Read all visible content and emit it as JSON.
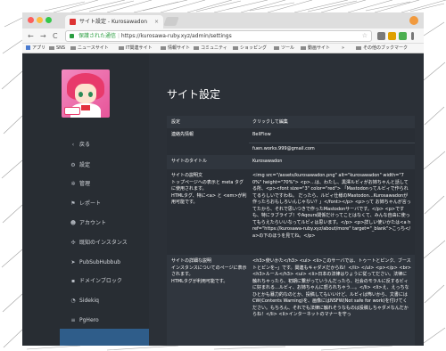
{
  "browser": {
    "tab_title": "サイト設定 - Kurosawadon",
    "tab_close": "×",
    "secure_label": "保護された通信",
    "url": "https://kurosawa-ruby.xyz/admin/settings",
    "nav_back": "←",
    "nav_forward": "→",
    "nav_reload": "C",
    "star": "☆",
    "bookmarks": [
      "アプリ",
      "SNS",
      "ニュースサイト",
      "IT関連サイト",
      "情報サイト",
      "コミュニティ",
      "ショッピング",
      "ツール",
      "動画サイト"
    ],
    "bookmarks_more": "»",
    "bookmarks_other": "その他のブックマーク"
  },
  "sidebar": {
    "items": [
      {
        "label": "戻る",
        "icon": "chevron-left-icon",
        "glyph": "‹"
      },
      {
        "label": "設定",
        "icon": "gear-icon",
        "glyph": "⚙"
      },
      {
        "label": "管理",
        "icon": "cogs-icon",
        "glyph": "✲"
      },
      {
        "label": "レポート",
        "icon": "flag-icon",
        "glyph": "⚑"
      },
      {
        "label": "アカウント",
        "icon": "users-icon",
        "glyph": "☻"
      },
      {
        "label": "既知のインスタンス",
        "icon": "network-icon",
        "glyph": "✣"
      },
      {
        "label": "PubSubHubbub",
        "icon": "paper-plane-icon",
        "glyph": "➤"
      },
      {
        "label": "ドメインブロック",
        "icon": "lock-icon",
        "glyph": "▪"
      },
      {
        "label": "Sidekiq",
        "icon": "wifi-icon",
        "glyph": "◔"
      },
      {
        "label": "PgHero",
        "icon": "database-icon",
        "glyph": "≡"
      }
    ]
  },
  "main": {
    "title": "サイト設定",
    "header": {
      "label": "設定",
      "value": "クリックして編集"
    },
    "contact": {
      "label": "連絡先情報",
      "username": "BellFlow",
      "email": "fuen.works.999@gmail.com"
    },
    "site_title": {
      "label": "サイトのタイトル",
      "value": "Kurosawadon"
    },
    "description": {
      "label": "サイトの説明文",
      "note": "トップページへの表示と meta タグに使用されます。",
      "note2": "HTMLタグ、特に<a> と <em>が利用可能です。",
      "value": "<img src=\"/assets/kurosawadon.png\" alt=\"kurosawadon\" width=\"70%\" height=\"70%\"> <p>…は、わたし、黒澤ルビィがお姉ちゃんと話してる所、<p><font size=\"3\" color=\"red\"> 「Mastodonってルビィで作られてるらしいですわね。 だったら、ルビィ仕様のMastodon…Kurosawadonが作ったらおもしろいんじゃない？」</font></p> <p>って お姉ちゃんが言ってたから、それで思いつきで作ったMastodonサーバです。</p> <p>ですも、特にラブライブ！やAqours関係だけってことはなくて、みんな自由に使ってもらえたらいいなってルビィは思います。</p> <p>詳しい使いかたは<a href=\"https://kurosawa-ruby.xyz/about/more\" target=\"_blank\">こっち</a>の下のほうを見てね。</p>"
    },
    "extended": {
      "label": "サイトの詳細な説明",
      "note": "インスタンスについてのページに表示されます。",
      "note2": "HTMLタグが利用可能です。",
      "value": "<h3>使いかた</h3> <ul> <li>このサーバでは、トゥートとピンク、ブーストとピンを─」です。関連もキャダメだからね！</li> </ul> <p></p> <br> <h3>ルール</h3> <ul> <li>日本の法律はりょうに従ってださい。法律に触れちゃったら、初期に繋がっていうんだったら、社会のモラルに反するビィに好まれる…ルビィ、お姉ちゃんに怒られちゃう…。</li> <li>え、えっちなひとかも暴力的なのとか、投稿してもいいけど、ルビィは怖いから、文書には CW(Contents Warning)を、画像にはNSFW(Not safe for work)を付けてください。もちろん、それでも法律に触れそうなものは投稿しちゃダメなんだからね！</li> <li>インターネットのマナーを守っ"
    }
  }
}
